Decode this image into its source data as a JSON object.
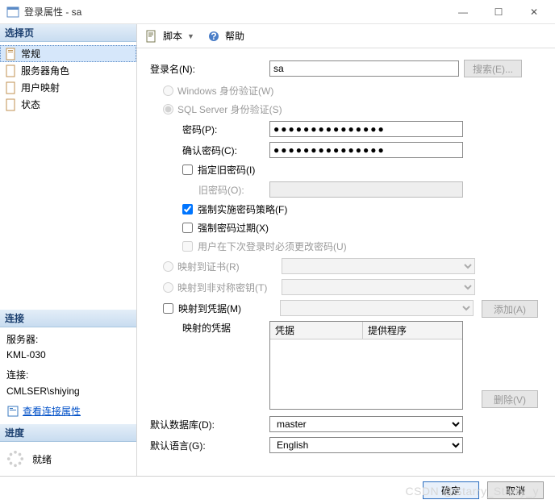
{
  "window": {
    "title": "登录属性 - sa"
  },
  "winbuttons": {
    "min": "—",
    "max": "☐",
    "close": "✕"
  },
  "left": {
    "select_page": "选择页",
    "nav": [
      {
        "label": "常规"
      },
      {
        "label": "服务器角色"
      },
      {
        "label": "用户映射"
      },
      {
        "label": "状态"
      }
    ],
    "connection_header": "连接",
    "server_label": "服务器:",
    "server_value": "KML-030",
    "conn_label": "连接:",
    "conn_value": "CMLSER\\shiying",
    "view_conn_props": "查看连接属性",
    "progress_header": "进度",
    "progress_status": "就绪"
  },
  "toolbar": {
    "script": "脚本",
    "help": "帮助",
    "dropdown": "▼"
  },
  "form": {
    "login_name_label": "登录名(N):",
    "login_name_value": "sa",
    "search_btn": "搜索(E)...",
    "windows_auth": "Windows 身份验证(W)",
    "sql_auth": "SQL Server 身份验证(S)",
    "password_label": "密码(P):",
    "password_value": "●●●●●●●●●●●●●●●",
    "confirm_label": "确认密码(C):",
    "confirm_value": "●●●●●●●●●●●●●●●",
    "specify_old": "指定旧密码(I)",
    "old_pwd_label": "旧密码(O):",
    "enforce_policy": "强制实施密码策略(F)",
    "enforce_expire": "强制密码过期(X)",
    "must_change": "用户在下次登录时必须更改密码(U)",
    "map_cert": "映射到证书(R)",
    "map_asym": "映射到非对称密钥(T)",
    "map_cred": "映射到凭据(M)",
    "add_btn": "添加(A)",
    "mapped_creds": "映射的凭据",
    "col_cred": "凭据",
    "col_provider": "提供程序",
    "remove_btn": "删除(V)",
    "default_db_label": "默认数据库(D):",
    "default_db_value": "master",
    "default_lang_label": "默认语言(G):",
    "default_lang_value": "English"
  },
  "footer": {
    "ok": "确定",
    "cancel": "取消"
  },
  "watermark": "CSDN @Starry_Starry_y"
}
